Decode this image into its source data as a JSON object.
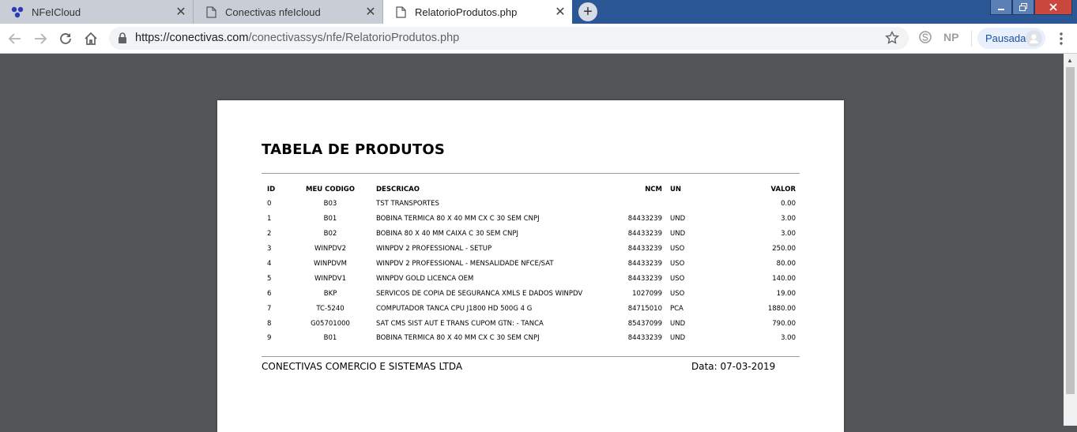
{
  "browser": {
    "tabs": [
      {
        "title": "NFeICloud",
        "icon": "nfe-logo-icon",
        "active": false
      },
      {
        "title": "Conectivas nfeIcloud",
        "icon": "document-icon",
        "active": false
      },
      {
        "title": "RelatorioProdutos.php",
        "icon": "document-icon",
        "active": true
      }
    ],
    "tab_close_glyph": "✕",
    "new_tab_glyph": "+",
    "url_host": "https://conectivas.com",
    "url_path": "/conectivassys/nfe/RelatorioProdutos.php",
    "ext_np": "NP",
    "profile_label": "Pausada"
  },
  "report": {
    "title": "TABELA DE PRODUTOS",
    "headers": {
      "id": "ID",
      "codigo": "MEU CODIGO",
      "descricao": "DESCRICAO",
      "ncm": "NCM",
      "un": "UN",
      "valor": "VALOR"
    },
    "rows": [
      {
        "id": "0",
        "codigo": "B03",
        "descricao": "TST TRANSPORTES",
        "ncm": "",
        "un": "",
        "valor": "0.00"
      },
      {
        "id": "1",
        "codigo": "B01",
        "descricao": "BOBINA TERMICA 80 X 40 MM CX C 30 SEM CNPJ",
        "ncm": "84433239",
        "un": "UND",
        "valor": "3.00"
      },
      {
        "id": "2",
        "codigo": "B02",
        "descricao": "BOBINA 80 X 40 MM CAIXA C 30 SEM CNPJ",
        "ncm": "84433239",
        "un": "UND",
        "valor": "3.00"
      },
      {
        "id": "3",
        "codigo": "WINPDV2",
        "descricao": "WINPDV 2 PROFESSIONAL - SETUP",
        "ncm": "84433239",
        "un": "USO",
        "valor": "250.00"
      },
      {
        "id": "4",
        "codigo": "WINPDVM",
        "descricao": "WINPDV 2 PROFESSIONAL - MENSALIDADE NFCE/SAT",
        "ncm": "84433239",
        "un": "USO",
        "valor": "80.00"
      },
      {
        "id": "5",
        "codigo": "WINPDV1",
        "descricao": "WINPDV GOLD LICENCA OEM",
        "ncm": "84433239",
        "un": "USO",
        "valor": "140.00"
      },
      {
        "id": "6",
        "codigo": "BKP",
        "descricao": "SERVICOS DE COPIA DE SEGURANCA XMLS E DADOS WINPDV",
        "ncm": "1027099",
        "un": "USO",
        "valor": "19.00"
      },
      {
        "id": "7",
        "codigo": "TC-5240",
        "descricao": "COMPUTADOR TANCA CPU J1800 HD 500G 4 G",
        "ncm": "84715010",
        "un": "PCA",
        "valor": "1880.00"
      },
      {
        "id": "8",
        "codigo": "G05701000",
        "descricao": "SAT CMS SIST AUT E TRANS CUPOM GTN: - TANCA",
        "ncm": "85437099",
        "un": "UND",
        "valor": "790.00"
      },
      {
        "id": "9",
        "codigo": "B01",
        "descricao": "BOBINA TERMICA 80 X 40 MM CX C 30 SEM CNPJ",
        "ncm": "84433239",
        "un": "UND",
        "valor": "3.00"
      }
    ],
    "footer_company": "CONECTIVAS COMERCIO E SISTEMAS LTDA",
    "footer_date": "Data: 07-03-2019"
  },
  "colors": {
    "tabstrip": "#2b5797",
    "viewer_bg": "#525659",
    "accent": "#1a73e8"
  }
}
